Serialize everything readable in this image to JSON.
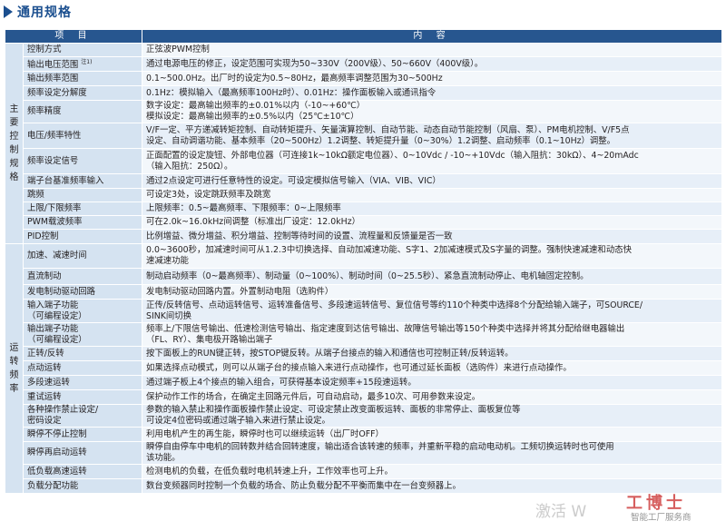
{
  "page_title": "通用规格",
  "header": {
    "item": "项 目",
    "content": "内 容"
  },
  "categories": {
    "main": "主要控制规格",
    "run": "运转频率"
  },
  "rows": [
    {
      "item": "控制方式",
      "content": "正弦波PWM控制"
    },
    {
      "item": "输出电压范围",
      "note": "注1)",
      "content": "通过电源电压的修正，设定范围可实现为50~330V（200V级）、50~660V（400V级）。"
    },
    {
      "item": "输出频率范围",
      "content": "0.1~500.0Hz。出厂时的设定为0.5~80Hz，最高频率调整范围为30~500Hz"
    },
    {
      "item": "频率设定分解度",
      "content": "0.1Hz：模拟输入（最高频率100Hz时）、0.01Hz：操作面板输入或通讯指令"
    },
    {
      "item": "频率精度",
      "content": "数字设定：最高输出频率的±0.01%以内（-10~+60℃）\n模拟设定：最高输出频率的±0.5%以内（25℃±10℃）"
    },
    {
      "item": "电压/频率特性",
      "content": "V/F一定、平方递减转矩控制、自动转矩提升、矢量演算控制、自动节能、动态自动节能控制（风扇、泵）、PM电机控制、V/F5点\n设定、自动调谐功能、基本频率（20~500Hz）1.2调整、转矩提升量（0~30%）1.2调整、启动频率（0.1~10Hz）调整。"
    },
    {
      "item": "频率设定信号",
      "content": "正面配置的设定旋钮、外部电位器（可连接1k~10kΩ额定电位器）、0~10Vdc / -10~+10Vdc（输入阻抗：30kΩ）、4~20mAdc\n（输入阻抗：250Ω）。"
    },
    {
      "item": "端子台基准频率输入",
      "content": "通过2点设定可进行任意特性的设定。可设定模拟信号输入（VIA、VIB、VIC）"
    },
    {
      "item": "跳频",
      "content": "可设定3处，设定跳跃频率及跳宽"
    },
    {
      "item": "上限/下限频率",
      "content": "上限频率：0.5~最高频率、下限频率：0~上限频率"
    },
    {
      "item": "PWM载波频率",
      "content": "可在2.0k~16.0kHz间调整（标准出厂设定：12.0kHz）"
    },
    {
      "item": "PID控制",
      "content": "比例增益、微分增益、积分增益、控制等待时间的设置、流程量和反馈量是否一致"
    },
    {
      "item": "加速、减速时间",
      "content": "0.0~3600秒，加减速时间可从1.2.3中切换选择、自动加减速功能、S字1、2加减速模式及S字量的调整。强制快速减速和动态快\n速减速功能"
    },
    {
      "item": "直流制动",
      "content": "制动启动频率（0~最高频率）、制动量（0~100%）、制动时间（0~25.5秒）、紧急直流制动停止、电机轴固定控制。"
    },
    {
      "item": "发电制动驱动回路",
      "content": "发电制动驱动回路内置。外置制动电阻（选购件）"
    },
    {
      "item": "输入端子功能\n（可编程设定）",
      "content": "正传/反转信号、点动运转信号、运转准备信号、多段速运转信号、复位信号等约110个种类中选择8个分配给输入端子，可SOURCE/\nSINK间切换"
    },
    {
      "item": "输出端子功能\n（可编程设定）",
      "content": "频率上/下限信号输出、低速检测信号输出、指定速度到达信号输出、故障信号输出等150个种类中选择并将其分配给继电器输出\n（FL、RY）、集电极开路输出端子"
    },
    {
      "item": "正转/反转",
      "content": "按下面板上的RUN键正转，按STOP键反转。从端子台接点的输入和通信也可控制正转/反转运转。"
    },
    {
      "item": "点动运转",
      "content": "如果选择点动模式，则可以从端子台的接点输入来进行点动操作，也可通过延长面板（选购件）来进行点动操作。"
    },
    {
      "item": "多段速运转",
      "content": "通过端子板上4个接点的输入组合，可获得基本设定频率+15段速运转。"
    },
    {
      "item": "重试运转",
      "content": "保护动作工作的场合，在确定主回路元件后，可自动启动，最多10次、可用参数来设定。"
    },
    {
      "item": "各种操作禁止设定/\n密码设定",
      "content": "参数的输入禁止和操作面板操作禁止设定、可设定禁止改变面板运转、面板的非常停止、面板复位等\n可设定4位密码或通过端子输入来进行禁止设定。"
    },
    {
      "item": "瞬停不停止控制",
      "content": "利用电机产生的再生能，瞬停时也可以继续运转（出厂时OFF）"
    },
    {
      "item": "瞬停再启动运转",
      "content": "瞬停自由停车中电机的回转数并结合回转速度，输出适合该转速的频率，并重新平稳的启动电动机。工频切换运转时也可使用\n该功能。"
    },
    {
      "item": "低负载高速运转",
      "content": "检测电机的负载，在低负载时电机转速上升，工作效率也可上升。"
    },
    {
      "item": "负载分配功能",
      "content": "数台变频器同时控制一个负载的场合、防止负载分配不平衡而集中在一台变频器上。"
    }
  ],
  "watermark": {
    "activate": "激活 W",
    "brand": "工博士",
    "service": "智能工厂服务商"
  },
  "colors": {
    "header_bg": "#27568f",
    "label_bg": "#d5e3f1",
    "content_bg": "#f3f7fb",
    "title": "#1b4f8f"
  }
}
